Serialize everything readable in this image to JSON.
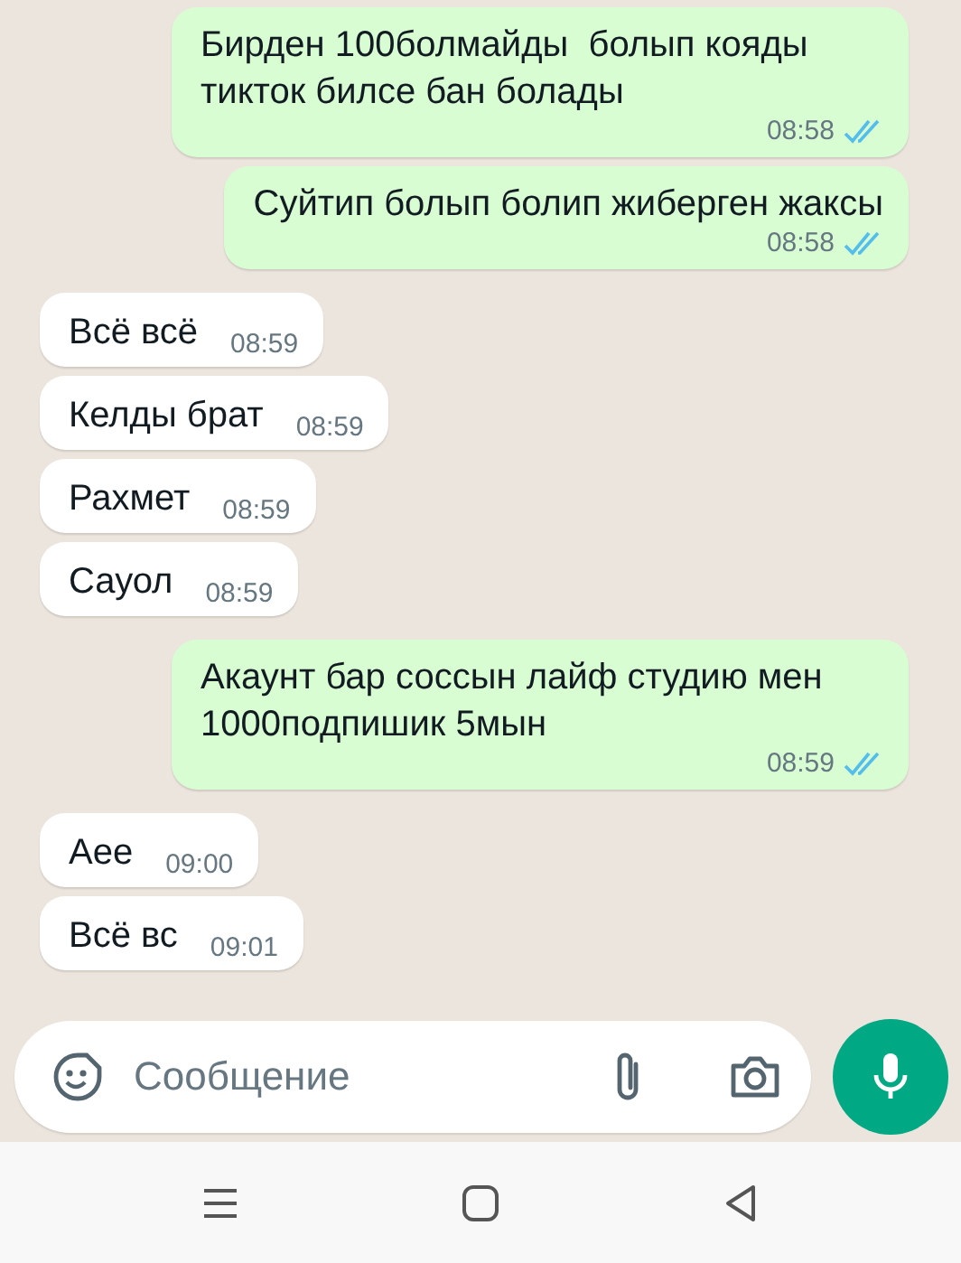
{
  "messages": [
    {
      "kind": "outgoing",
      "text": "Бирден 100болмайды  болып кояды тикток билсе бан болады",
      "time": "08:58",
      "read": true
    },
    {
      "kind": "outgoing",
      "text": "Суйтип болып болип жиберген жаксы",
      "time": "08:58",
      "read": true
    },
    {
      "kind": "incoming",
      "text": "Всё всё",
      "time": "08:59"
    },
    {
      "kind": "incoming",
      "text": "Келды брат",
      "time": "08:59"
    },
    {
      "kind": "incoming",
      "text": "Рахмет",
      "time": "08:59"
    },
    {
      "kind": "incoming",
      "text": "Сауол",
      "time": "08:59"
    },
    {
      "kind": "outgoing",
      "text": "Акаунт бар соссын лайф студию мен 1000подпишик 5мын",
      "time": "08:59",
      "read": true
    },
    {
      "kind": "incoming",
      "text": "Аее",
      "time": "09:00"
    },
    {
      "kind": "incoming",
      "text": "Всё вс",
      "time": "09:01"
    }
  ],
  "composer": {
    "placeholder": "Сообщение"
  }
}
